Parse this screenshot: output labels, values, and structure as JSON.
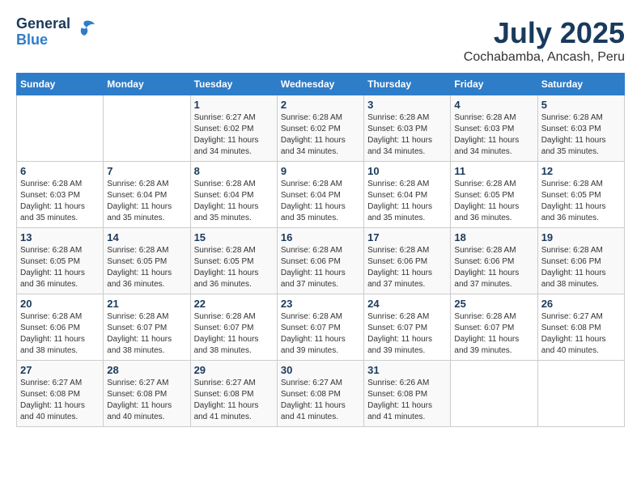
{
  "header": {
    "logo_general": "General",
    "logo_blue": "Blue",
    "title": "July 2025",
    "subtitle": "Cochabamba, Ancash, Peru"
  },
  "calendar": {
    "days_of_week": [
      "Sunday",
      "Monday",
      "Tuesday",
      "Wednesday",
      "Thursday",
      "Friday",
      "Saturday"
    ],
    "weeks": [
      [
        {
          "day": "",
          "info": ""
        },
        {
          "day": "",
          "info": ""
        },
        {
          "day": "1",
          "info": "Sunrise: 6:27 AM\nSunset: 6:02 PM\nDaylight: 11 hours and 34 minutes."
        },
        {
          "day": "2",
          "info": "Sunrise: 6:28 AM\nSunset: 6:02 PM\nDaylight: 11 hours and 34 minutes."
        },
        {
          "day": "3",
          "info": "Sunrise: 6:28 AM\nSunset: 6:03 PM\nDaylight: 11 hours and 34 minutes."
        },
        {
          "day": "4",
          "info": "Sunrise: 6:28 AM\nSunset: 6:03 PM\nDaylight: 11 hours and 34 minutes."
        },
        {
          "day": "5",
          "info": "Sunrise: 6:28 AM\nSunset: 6:03 PM\nDaylight: 11 hours and 35 minutes."
        }
      ],
      [
        {
          "day": "6",
          "info": "Sunrise: 6:28 AM\nSunset: 6:03 PM\nDaylight: 11 hours and 35 minutes."
        },
        {
          "day": "7",
          "info": "Sunrise: 6:28 AM\nSunset: 6:04 PM\nDaylight: 11 hours and 35 minutes."
        },
        {
          "day": "8",
          "info": "Sunrise: 6:28 AM\nSunset: 6:04 PM\nDaylight: 11 hours and 35 minutes."
        },
        {
          "day": "9",
          "info": "Sunrise: 6:28 AM\nSunset: 6:04 PM\nDaylight: 11 hours and 35 minutes."
        },
        {
          "day": "10",
          "info": "Sunrise: 6:28 AM\nSunset: 6:04 PM\nDaylight: 11 hours and 35 minutes."
        },
        {
          "day": "11",
          "info": "Sunrise: 6:28 AM\nSunset: 6:05 PM\nDaylight: 11 hours and 36 minutes."
        },
        {
          "day": "12",
          "info": "Sunrise: 6:28 AM\nSunset: 6:05 PM\nDaylight: 11 hours and 36 minutes."
        }
      ],
      [
        {
          "day": "13",
          "info": "Sunrise: 6:28 AM\nSunset: 6:05 PM\nDaylight: 11 hours and 36 minutes."
        },
        {
          "day": "14",
          "info": "Sunrise: 6:28 AM\nSunset: 6:05 PM\nDaylight: 11 hours and 36 minutes."
        },
        {
          "day": "15",
          "info": "Sunrise: 6:28 AM\nSunset: 6:05 PM\nDaylight: 11 hours and 36 minutes."
        },
        {
          "day": "16",
          "info": "Sunrise: 6:28 AM\nSunset: 6:06 PM\nDaylight: 11 hours and 37 minutes."
        },
        {
          "day": "17",
          "info": "Sunrise: 6:28 AM\nSunset: 6:06 PM\nDaylight: 11 hours and 37 minutes."
        },
        {
          "day": "18",
          "info": "Sunrise: 6:28 AM\nSunset: 6:06 PM\nDaylight: 11 hours and 37 minutes."
        },
        {
          "day": "19",
          "info": "Sunrise: 6:28 AM\nSunset: 6:06 PM\nDaylight: 11 hours and 38 minutes."
        }
      ],
      [
        {
          "day": "20",
          "info": "Sunrise: 6:28 AM\nSunset: 6:06 PM\nDaylight: 11 hours and 38 minutes."
        },
        {
          "day": "21",
          "info": "Sunrise: 6:28 AM\nSunset: 6:07 PM\nDaylight: 11 hours and 38 minutes."
        },
        {
          "day": "22",
          "info": "Sunrise: 6:28 AM\nSunset: 6:07 PM\nDaylight: 11 hours and 38 minutes."
        },
        {
          "day": "23",
          "info": "Sunrise: 6:28 AM\nSunset: 6:07 PM\nDaylight: 11 hours and 39 minutes."
        },
        {
          "day": "24",
          "info": "Sunrise: 6:28 AM\nSunset: 6:07 PM\nDaylight: 11 hours and 39 minutes."
        },
        {
          "day": "25",
          "info": "Sunrise: 6:28 AM\nSunset: 6:07 PM\nDaylight: 11 hours and 39 minutes."
        },
        {
          "day": "26",
          "info": "Sunrise: 6:27 AM\nSunset: 6:08 PM\nDaylight: 11 hours and 40 minutes."
        }
      ],
      [
        {
          "day": "27",
          "info": "Sunrise: 6:27 AM\nSunset: 6:08 PM\nDaylight: 11 hours and 40 minutes."
        },
        {
          "day": "28",
          "info": "Sunrise: 6:27 AM\nSunset: 6:08 PM\nDaylight: 11 hours and 40 minutes."
        },
        {
          "day": "29",
          "info": "Sunrise: 6:27 AM\nSunset: 6:08 PM\nDaylight: 11 hours and 41 minutes."
        },
        {
          "day": "30",
          "info": "Sunrise: 6:27 AM\nSunset: 6:08 PM\nDaylight: 11 hours and 41 minutes."
        },
        {
          "day": "31",
          "info": "Sunrise: 6:26 AM\nSunset: 6:08 PM\nDaylight: 11 hours and 41 minutes."
        },
        {
          "day": "",
          "info": ""
        },
        {
          "day": "",
          "info": ""
        }
      ]
    ]
  }
}
